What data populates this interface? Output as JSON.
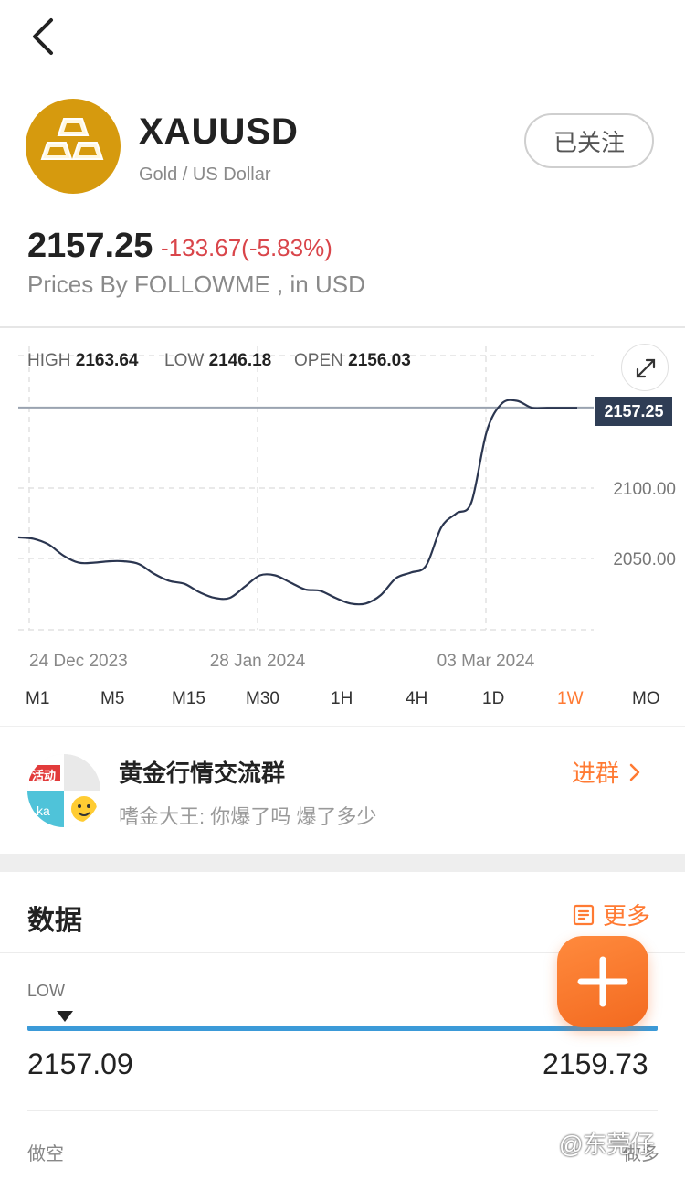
{
  "header": {
    "symbol": "XAUUSD",
    "fullname": "Gold / US Dollar",
    "follow_label": "已关注"
  },
  "quote": {
    "price": "2157.25",
    "change": "-133.67(-5.83%)",
    "source": "Prices By FOLLOWME , in USD"
  },
  "stats": {
    "high_label": "HIGH",
    "high_value": "2163.64",
    "low_label": "LOW",
    "low_value": "2146.18",
    "open_label": "OPEN",
    "open_value": "2156.03"
  },
  "chart_data": {
    "type": "line",
    "series": [
      {
        "values": [
          2065,
          2064,
          2060,
          2052,
          2047,
          2047,
          2048,
          2048,
          2046,
          2039,
          2034,
          2032,
          2026,
          2022,
          2022,
          2030,
          2038,
          2038,
          2033,
          2028,
          2027,
          2022,
          2018,
          2018,
          2024,
          2036,
          2040,
          2045,
          2072,
          2082,
          2090,
          2140,
          2160,
          2162,
          2157,
          2157,
          2157,
          2157
        ]
      }
    ],
    "x_tick_labels": [
      "24 Dec 2023",
      "28 Jan 2024",
      "03 Mar 2024"
    ],
    "y_tick_labels": [
      "2100.00",
      "2050.00"
    ],
    "last_price_label": "2157.25",
    "last_value": 2157.25,
    "grid": true
  },
  "timeframes": [
    {
      "label": "M1",
      "active": false
    },
    {
      "label": "M5",
      "active": false
    },
    {
      "label": "M15",
      "active": false
    },
    {
      "label": "M30",
      "active": false
    },
    {
      "label": "1H",
      "active": false
    },
    {
      "label": "4H",
      "active": false
    },
    {
      "label": "1D",
      "active": false
    },
    {
      "label": "1W",
      "active": true
    },
    {
      "label": "MO",
      "active": false
    }
  ],
  "group": {
    "name": "黄金行情交流群",
    "message": "嗜金大王: 你爆了吗 爆了多少",
    "join_label": "进群",
    "avatar_tag": "活动",
    "avatar_tag2": "ka"
  },
  "data_section": {
    "title": "数据",
    "more_label": "更多",
    "low_label": "LOW",
    "high_label": "H",
    "low_value": "2157.09",
    "high_value": "2159.73",
    "short_label": "做空",
    "long_label": "做多"
  },
  "watermark": "@东莞仔",
  "colors": {
    "accent": "#ff7a33",
    "down": "#d9454a",
    "bar": "#3b9ad8",
    "gold": "#d69a0e"
  }
}
